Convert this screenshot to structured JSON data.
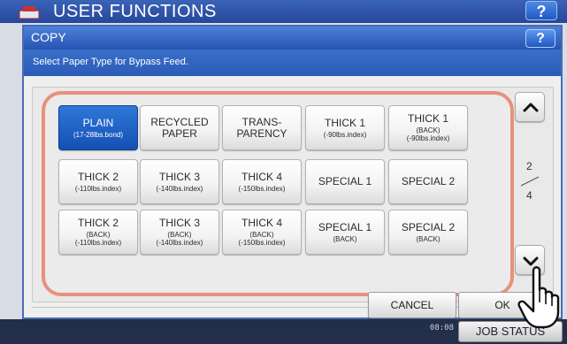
{
  "background": {
    "title": "USER FUNCTIONS",
    "help_label": "?",
    "clock_line1": "",
    "clock_line2": "08:08",
    "job_status_label": "JOB STATUS"
  },
  "dialog": {
    "title": "COPY",
    "help_label": "?",
    "instruction": "Select Paper Type for Bypass Feed.",
    "paper_types": [
      {
        "main": "PLAIN",
        "note": "(17-28lbs.bond)",
        "selected": true
      },
      {
        "main": "RECYCLED\nPAPER",
        "note": ""
      },
      {
        "main": "TRANS-\nPARENCY",
        "note": ""
      },
      {
        "main": "THICK 1",
        "note": "(-90lbs.index)"
      },
      {
        "main": "THICK 1",
        "note": "(BACK)\n(-90lbs.index)"
      },
      {
        "main": "THICK 2",
        "note": "(-110lbs.index)"
      },
      {
        "main": "THICK 3",
        "note": "(-140lbs.index)"
      },
      {
        "main": "THICK 4",
        "note": "(-150lbs.index)"
      },
      {
        "main": "SPECIAL 1",
        "note": ""
      },
      {
        "main": "SPECIAL 2",
        "note": ""
      },
      {
        "main": "THICK 2",
        "note": "(BACK)\n(-110lbs.index)"
      },
      {
        "main": "THICK 3",
        "note": "(BACK)\n(-140lbs.index)"
      },
      {
        "main": "THICK 4",
        "note": "(BACK)\n(-150lbs.index)"
      },
      {
        "main": "SPECIAL 1",
        "note": "(BACK)"
      },
      {
        "main": "SPECIAL 2",
        "note": "(BACK)"
      }
    ],
    "page_current": "2",
    "page_total": "4",
    "cancel_label": "CANCEL",
    "ok_label": "OK"
  },
  "icons": {
    "scroll_up": "chevron-up-icon",
    "scroll_down": "chevron-down-icon",
    "pointer": "hand-pointer-icon"
  },
  "colors": {
    "accent_blue": "#2653b3",
    "selected_button": "#1f64c8",
    "highlight_frame": "#e8917a"
  }
}
